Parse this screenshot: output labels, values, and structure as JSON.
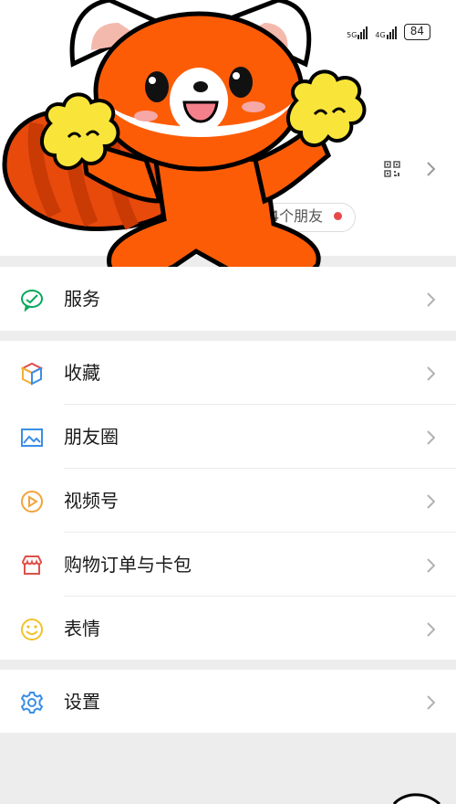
{
  "status_bar": {
    "net1": "5G",
    "net2": "4G",
    "battery": "84"
  },
  "profile": {
    "friends_text": "等4个朋友"
  },
  "menu": {
    "service": "服务",
    "favorites": "收藏",
    "moments": "朋友圈",
    "channels": "视频号",
    "orders": "购物订单与卡包",
    "stickers": "表情",
    "settings": "设置"
  },
  "icons": {
    "service": "wechat-pay-check-icon",
    "favorites": "cube-icon",
    "moments": "picture-icon",
    "channels": "play-circle-icon",
    "orders": "shop-card-icon",
    "stickers": "smiley-icon",
    "settings": "gear-icon"
  },
  "colors": {
    "accent_green": "#07c160",
    "text": "#1a1a1a",
    "bg": "#ededed",
    "panda_orange": "#fd5c07",
    "pompom_yellow": "#f9e53a"
  }
}
